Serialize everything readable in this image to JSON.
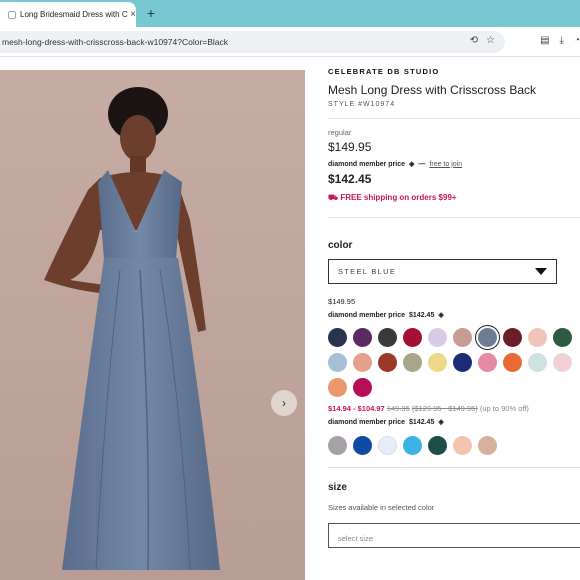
{
  "browser": {
    "tab_title": "Long Bridesmaid Dress with C",
    "tab_close": "×",
    "new_tab": "+",
    "url": "mesh-long-dress-with-crisscross-back-w10974?Color=Black"
  },
  "gallery": {
    "next": "›"
  },
  "product": {
    "brand": "CELEBRATE DB STUDIO",
    "name": "Mesh Long Dress with Crisscross Back",
    "style": "STYLE #W10974",
    "regular_label": "regular",
    "regular_price": "$149.95",
    "member_label": "diamond member price",
    "member_sep": "—",
    "member_link": "free to join",
    "member_price": "$142.45",
    "shipping": "FREE shipping on orders $99+"
  },
  "color": {
    "heading": "color",
    "selected": "STEEL BLUE",
    "price": "$149.95",
    "member_label": "diamond member price",
    "member_price": "$142.45",
    "swatches_row1": [
      "#2a3452",
      "#5b2a62",
      "#3a3a3c",
      "#a30f35",
      "#d9cbe8",
      "#c99b95",
      "#6d7b93",
      "#6a1e2c",
      "#eec3b9",
      "#2e5a43"
    ],
    "swatches_row2": [
      "#a7bfd6",
      "#e8a08e",
      "#9a3a26",
      "#a8a58a",
      "#f0d88b",
      "#1c2a78",
      "#e58aa3",
      "#ea6a33",
      "#cde3e1",
      "#f4cfd3"
    ],
    "swatches_row3": [
      "#e9986a",
      "#b70f57"
    ],
    "sale_range": "$14.94 - $104.97",
    "sale_orig1": "149.95",
    "sale_orig2": "($129.95 - $149.95)",
    "sale_note": "(up to 90% off)",
    "sale_member_label": "diamond member price",
    "sale_member_price": "$142.45",
    "swatches_row4": [
      "#a8a0a8",
      "#0f4aa3",
      "#e4edfa",
      "#3bb3e4",
      "#1f4d4a",
      "#f3c3ad",
      "#d4b19c"
    ]
  },
  "size": {
    "heading": "size",
    "subtitle": "Sizes available in selected color",
    "placeholder": "select size"
  }
}
